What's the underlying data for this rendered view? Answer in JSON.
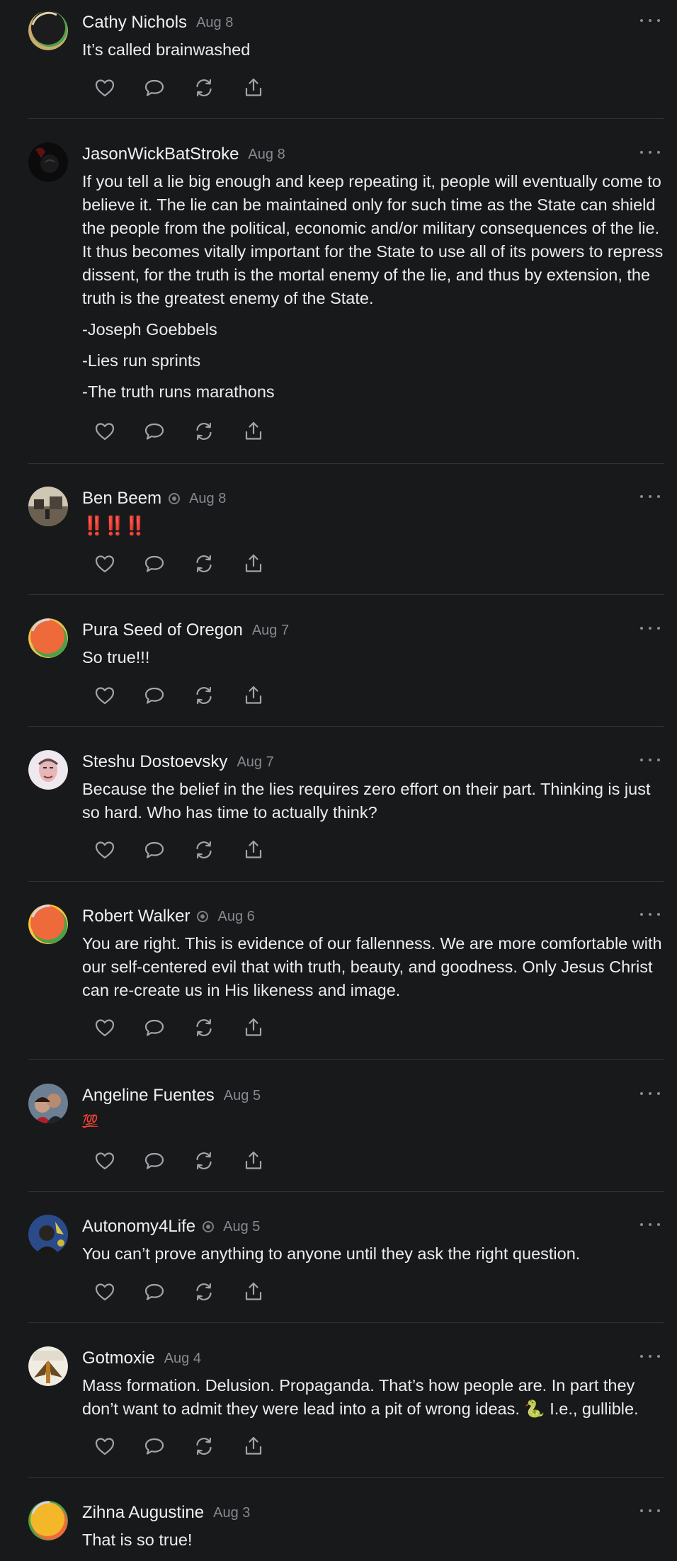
{
  "comments": [
    {
      "name": "Cathy Nichols",
      "date": "Aug 8",
      "text": "It’s called brainwashed"
    },
    {
      "name": "JasonWickBatStroke",
      "date": "Aug 8",
      "p1": "If you tell a lie big enough and keep repeating it, people will eventually come to believe it. The lie can be maintained only for such time as the State can shield the people from the political, economic and/or military consequences of the lie. It thus becomes vitally important for the State to use all of its powers to repress dissent, for the truth is the mortal enemy of the lie, and thus by extension, the truth is the greatest enemy of the State.",
      "p2": "-Joseph Goebbels",
      "p3": "-Lies run sprints",
      "p4": "-The truth runs marathons"
    },
    {
      "name": "Ben Beem",
      "date": "Aug 8",
      "text": "‼️‼️‼️"
    },
    {
      "name": "Pura Seed of Oregon",
      "date": "Aug 7",
      "text": "So true!!!"
    },
    {
      "name": "Steshu Dostoevsky",
      "date": "Aug 7",
      "text": "Because the belief in the lies requires zero effort on their part. Thinking is just so hard. Who has time to actually think?"
    },
    {
      "name": "Robert Walker",
      "date": "Aug 6",
      "text": "You are right. This is evidence of our fallenness. We are more comfortable with our self-centered evil that with truth, beauty, and goodness. Only Jesus Christ can re-create us in His likeness and image."
    },
    {
      "name": "Angeline Fuentes",
      "date": "Aug 5",
      "text": "💯"
    },
    {
      "name": "Autonomy4Life",
      "date": "Aug 5",
      "text": "You can’t prove anything to anyone until they ask the right question."
    },
    {
      "name": "Gotmoxie",
      "date": "Aug 4",
      "text": "Mass formation. Delusion. Propaganda. That’s how people are. In part they don’t want to admit they were lead into a pit of wrong ideas. 🐍 I.e., gullible."
    },
    {
      "name": "Zihna Augustine",
      "date": "Aug 3",
      "text": "That is so true!"
    }
  ],
  "icons": [
    "heart-icon",
    "comment-icon",
    "restack-icon",
    "share-icon",
    "more-icon",
    "subscriber-badge-icon"
  ],
  "colors": {
    "background": "#18191b",
    "text": "#ecedee",
    "muted": "#868990",
    "divider": "#303236"
  }
}
